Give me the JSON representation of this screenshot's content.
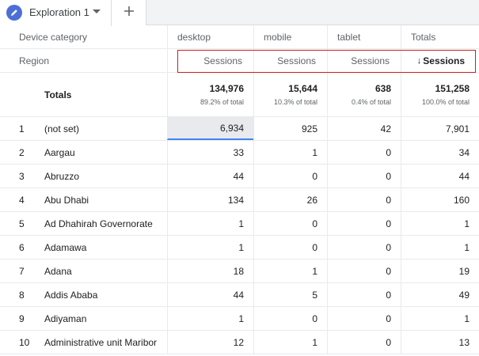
{
  "tabs": {
    "active_label": "Exploration 1",
    "icon": "pencil-icon",
    "add_icon": "plus-icon"
  },
  "headers": {
    "dimension_label": "Device category",
    "columns": [
      "desktop",
      "mobile",
      "tablet",
      "Totals"
    ]
  },
  "metric_row": {
    "dimension_label": "Region",
    "metrics": [
      "Sessions",
      "Sessions",
      "Sessions",
      "Sessions"
    ],
    "sort_arrow": "↓"
  },
  "totals": {
    "label": "Totals",
    "values": [
      {
        "value": "134,976",
        "pct": "89.2% of total"
      },
      {
        "value": "15,644",
        "pct": "10.3% of total"
      },
      {
        "value": "638",
        "pct": "0.4% of total"
      },
      {
        "value": "151,258",
        "pct": "100.0% of total"
      }
    ]
  },
  "rows": [
    {
      "idx": "1",
      "region": "(not set)",
      "desktop": "6,934",
      "mobile": "925",
      "tablet": "42",
      "total": "7,901"
    },
    {
      "idx": "2",
      "region": "Aargau",
      "desktop": "33",
      "mobile": "1",
      "tablet": "0",
      "total": "34"
    },
    {
      "idx": "3",
      "region": "Abruzzo",
      "desktop": "44",
      "mobile": "0",
      "tablet": "0",
      "total": "44"
    },
    {
      "idx": "4",
      "region": "Abu Dhabi",
      "desktop": "134",
      "mobile": "26",
      "tablet": "0",
      "total": "160"
    },
    {
      "idx": "5",
      "region": "Ad Dhahirah Governorate",
      "desktop": "1",
      "mobile": "0",
      "tablet": "0",
      "total": "1"
    },
    {
      "idx": "6",
      "region": "Adamawa",
      "desktop": "1",
      "mobile": "0",
      "tablet": "0",
      "total": "1"
    },
    {
      "idx": "7",
      "region": "Adana",
      "desktop": "18",
      "mobile": "1",
      "tablet": "0",
      "total": "19"
    },
    {
      "idx": "8",
      "region": "Addis Ababa",
      "desktop": "44",
      "mobile": "5",
      "tablet": "0",
      "total": "49"
    },
    {
      "idx": "9",
      "region": "Adiyaman",
      "desktop": "1",
      "mobile": "0",
      "tablet": "0",
      "total": "1"
    },
    {
      "idx": "10",
      "region": "Administrative unit Maribor",
      "desktop": "12",
      "mobile": "1",
      "tablet": "0",
      "total": "13"
    }
  ],
  "colors": {
    "accent": "#4285f4",
    "selection_border": "#c5221f",
    "tab_icon": "#4b6fd6"
  }
}
